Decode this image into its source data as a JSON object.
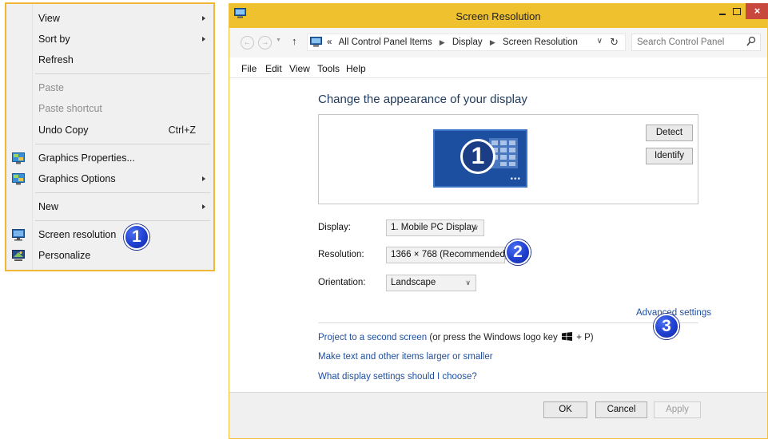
{
  "context_menu": {
    "items": [
      {
        "label": "View",
        "submenu": true
      },
      {
        "label": "Sort by",
        "submenu": true
      },
      {
        "label": "Refresh"
      },
      {
        "label": "Paste",
        "disabled": true
      },
      {
        "label": "Paste shortcut",
        "disabled": true
      },
      {
        "label": "Undo Copy",
        "shortcut": "Ctrl+Z"
      },
      {
        "label": "Graphics Properties...",
        "icon": "graphics-icon"
      },
      {
        "label": "Graphics Options",
        "icon": "graphics-icon",
        "submenu": true
      },
      {
        "label": "New",
        "submenu": true
      },
      {
        "label": "Screen resolution",
        "icon": "display-icon"
      },
      {
        "label": "Personalize",
        "icon": "personalize-icon"
      }
    ]
  },
  "badges": [
    "1",
    "2",
    "3"
  ],
  "window": {
    "title": "Screen Resolution",
    "close_glyph": "×",
    "address": {
      "crumb_prefix": "«",
      "crumbs": [
        "All Control Panel Items",
        "Display",
        "Screen Resolution"
      ],
      "search_placeholder": "Search Control Panel"
    },
    "menus": [
      "File",
      "Edit",
      "View",
      "Tools",
      "Help"
    ],
    "heading": "Change the appearance of your display",
    "preview": {
      "monitor_number": "1",
      "monitor_dots": "•••",
      "detect_label": "Detect",
      "identify_label": "Identify"
    },
    "fields": {
      "display_label": "Display:",
      "display_value": "1. Mobile PC Display",
      "resolution_label": "Resolution:",
      "resolution_value": "1366 × 768 (Recommended)",
      "orientation_label": "Orientation:",
      "orientation_value": "Landscape"
    },
    "advanced_settings": "Advanced settings",
    "links": {
      "project_link": "Project to a second screen",
      "project_suffix": "(or press the Windows logo key",
      "project_key_suffix": "+ P)",
      "text_size_link": "Make text and other items larger or smaller",
      "choose_link": "What display settings should I choose?"
    },
    "buttons": {
      "ok": "OK",
      "cancel": "Cancel",
      "apply": "Apply"
    }
  },
  "colors": {
    "accent": "#f0c12e",
    "badge": "#1f3fd0",
    "link": "#1f4e9e",
    "monitor": "#1d4fa0"
  }
}
